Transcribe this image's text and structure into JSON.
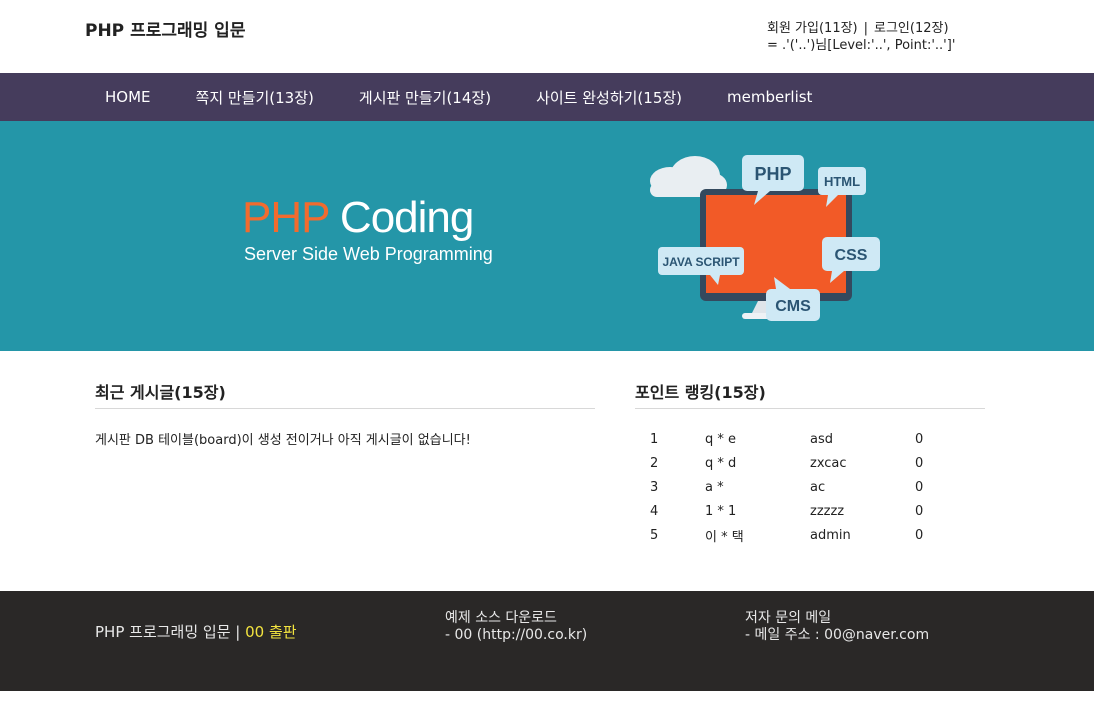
{
  "header": {
    "site_title": "PHP 프로그래밍 입문",
    "join_link": "회원 가입(11장)",
    "separator": "|",
    "login_link": "로그인(12장)",
    "user_status": "= .'('..')님[Level:'..', Point:'..']'"
  },
  "nav": {
    "items": [
      {
        "label": "HOME"
      },
      {
        "label": "쪽지 만들기(13장)"
      },
      {
        "label": "게시판 만들기(14장)"
      },
      {
        "label": "사이트 완성하기(15장)"
      },
      {
        "label": "memberlist"
      }
    ]
  },
  "banner": {
    "title_php": "PHP",
    "title_coding": "Coding",
    "subtitle": "Server Side Web Programming",
    "bubbles": {
      "php": "PHP",
      "html": "HTML",
      "css": "CSS",
      "javascript": "JAVA SCRIPT",
      "cms": "CMS"
    },
    "colors": {
      "background": "#2496a8",
      "accent": "#f26b2e",
      "bubble": "#cfe9f5",
      "bubble_text": "#2b5573"
    }
  },
  "recent_posts": {
    "title": "최근 게시글(15장)",
    "empty_message": "게시판 DB 테이블(board)이 생성 전이거나 아직 게시글이 없습니다!"
  },
  "ranking": {
    "title": "포인트 랭킹(15장)",
    "rows": [
      {
        "rank": "1",
        "name": "q * e",
        "id": "asd",
        "point": "0"
      },
      {
        "rank": "2",
        "name": "q * d",
        "id": "zxcac",
        "point": "0"
      },
      {
        "rank": "3",
        "name": "a *",
        "id": "ac",
        "point": "0"
      },
      {
        "rank": "4",
        "name": "1 * 1",
        "id": "zzzzz",
        "point": "0"
      },
      {
        "rank": "5",
        "name": "이 * 택",
        "id": "admin",
        "point": "0"
      }
    ]
  },
  "footer": {
    "brand": "PHP 프로그래밍 입문",
    "separator": "|",
    "publisher": "00 출판",
    "download_title": "예제 소스 다운로드",
    "download_link": "- 00 (http://00.co.kr)",
    "contact_title": "저자 문의 메일",
    "contact_email": "- 메일 주소 : 00@naver.com"
  }
}
